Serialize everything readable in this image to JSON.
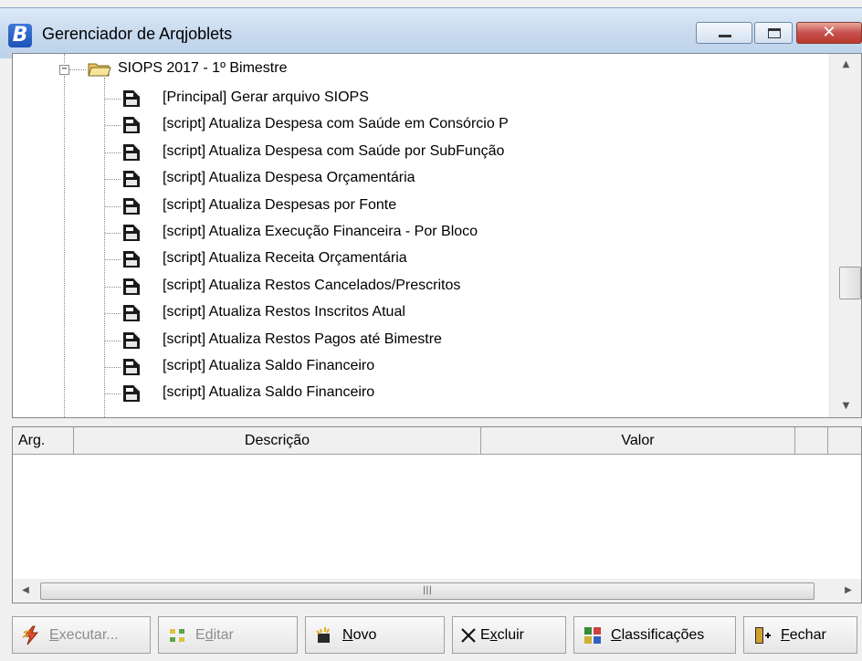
{
  "window": {
    "title": "Gerenciador de Arqjoblets",
    "app_icon_letter": "B",
    "close_glyph": "✕"
  },
  "tree": {
    "expander": "−",
    "root_label": "SIOPS 2017 - 1º Bimestre",
    "items": [
      {
        "label": "[Principal] Gerar arquivo SIOPS"
      },
      {
        "label": "[script] Atualiza Despesa com Saúde em Consórcio P"
      },
      {
        "label": "[script] Atualiza Despesa com Saúde por SubFunção"
      },
      {
        "label": "[script] Atualiza Despesa Orçamentária"
      },
      {
        "label": "[script] Atualiza Despesas por Fonte"
      },
      {
        "label": "[script] Atualiza Execução Financeira - Por Bloco"
      },
      {
        "label": "[script] Atualiza Receita Orçamentária"
      },
      {
        "label": "[script] Atualiza Restos Cancelados/Prescritos"
      },
      {
        "label": "[script] Atualiza Restos Inscritos Atual"
      },
      {
        "label": "[script] Atualiza Restos Pagos até Bimestre"
      },
      {
        "label": "[script] Atualiza Saldo Financeiro"
      },
      {
        "label": "[script] Atualiza Saldo Financeiro"
      }
    ],
    "scroll_up": "▲",
    "scroll_down": "▼"
  },
  "grid": {
    "columns": [
      "Arg.",
      "Descrição",
      "Valor",
      "",
      ""
    ],
    "scroll_left": "◀",
    "scroll_right": "▶",
    "thumb_grip": "|||"
  },
  "toolbar": {
    "buttons": [
      {
        "first": "E",
        "rest": "xecutar...",
        "icon": "lightning-icon",
        "disabled": true
      },
      {
        "first": "E",
        "rest": "ditar",
        "icon": "edit-blocks-icon",
        "disabled": true,
        "underline_second": true,
        "pre": "E",
        "mid": "d",
        "post": "itar"
      },
      {
        "first": "N",
        "rest": "ovo",
        "icon": "new-sparkle-icon",
        "disabled": false
      },
      {
        "pre": "E",
        "mid": "x",
        "post": "cluir",
        "icon": "x-delete-icon",
        "disabled": false
      },
      {
        "first": "C",
        "rest": "lassificações",
        "icon": "classifications-icon",
        "disabled": false
      },
      {
        "first": "F",
        "rest": "echar",
        "icon": "exit-door-icon",
        "disabled": false
      }
    ]
  },
  "colors": {
    "disabled_text": "#8d8d8d",
    "close_button": "#c75050",
    "title_bar": "#c6d9ee"
  }
}
